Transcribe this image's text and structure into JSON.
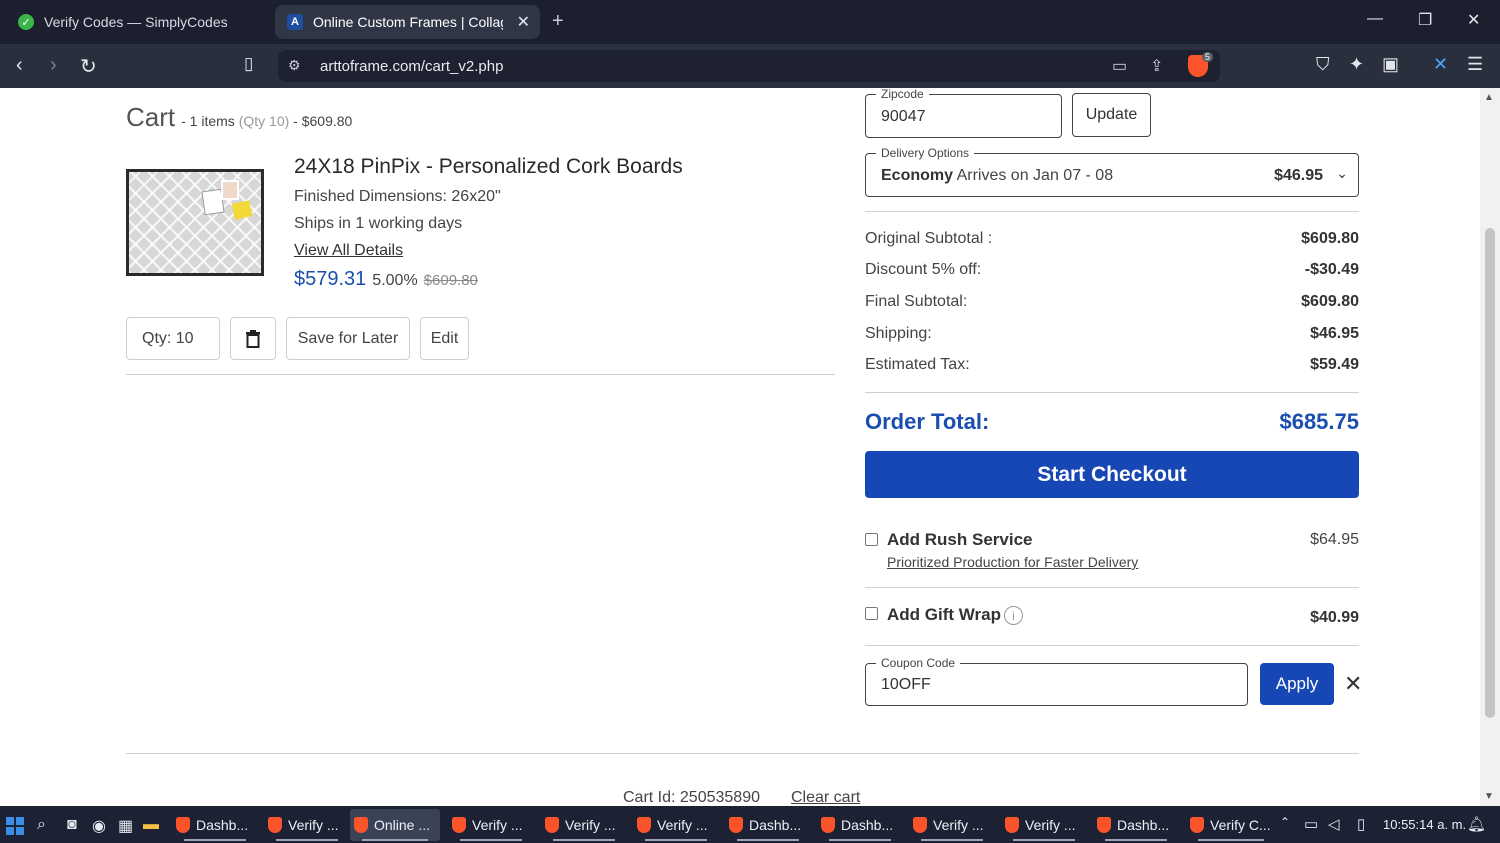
{
  "browser": {
    "tabs": [
      {
        "title": "Verify Codes — SimplyCodes",
        "active": false
      },
      {
        "title": "Online Custom Frames | Collage",
        "active": true
      }
    ],
    "url": "arttoframe.com/cart_v2.php",
    "brave_badge": "5"
  },
  "cart": {
    "title": "Cart",
    "items_text": "- 1 items",
    "qty_text": "(Qty 10)",
    "total_text": "- $609.80"
  },
  "product": {
    "name": "24X18 PinPix - Personalized Cork Boards",
    "dimensions": "Finished Dimensions: 26x20\"",
    "ships": "Ships in 1 working days",
    "details_link": "View All Details",
    "price_now": "$579.31",
    "discount_pct": "5.00%",
    "price_old": "$609.80"
  },
  "actions": {
    "qty": "Qty: 10",
    "save_for_later": "Save for Later",
    "edit": "Edit"
  },
  "shipping_form": {
    "zip_legend": "Zipcode",
    "zip_value": "90047",
    "update": "Update",
    "delivery_legend": "Delivery Options",
    "delivery_bold": "Economy",
    "delivery_text": " Arrives on Jan 07 - 08",
    "delivery_price": "$46.95"
  },
  "summary": {
    "original_label": "Original Subtotal :",
    "original_value": "$609.80",
    "discount_label": "Discount 5% off:",
    "discount_value": "-$30.49",
    "final_label": "Final Subtotal:",
    "final_value": "$609.80",
    "shipping_label": "Shipping:",
    "shipping_value": "$46.95",
    "tax_label": "Estimated Tax:",
    "tax_value": "$59.49",
    "order_total_label": "Order Total:",
    "order_total_value": "$685.75",
    "checkout": "Start Checkout"
  },
  "options": {
    "rush_title": "Add Rush Service",
    "rush_sub": "Prioritized Production for Faster Delivery",
    "rush_price": "$64.95",
    "gift_title": "Add Gift Wrap",
    "gift_price": "$40.99"
  },
  "coupon": {
    "legend": "Coupon Code",
    "value": "10OFF",
    "apply": "Apply"
  },
  "footer": {
    "cart_id": "Cart Id: 250535890",
    "clear_cart": "Clear cart"
  },
  "taskbar": {
    "tasks": [
      "Dashb...",
      "Verify ...",
      "Online ...",
      "Verify ...",
      "Verify ...",
      "Verify ...",
      "Dashb...",
      "Dashb...",
      "Verify ...",
      "Verify ...",
      "Dashb...",
      "Verify C..."
    ],
    "clock": "10:55:14 a. m."
  }
}
